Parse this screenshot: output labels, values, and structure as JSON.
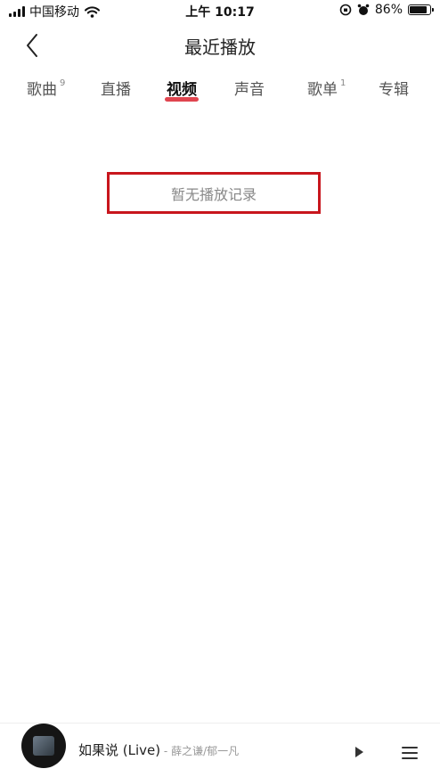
{
  "status_bar": {
    "carrier": "中国移动",
    "time": "上午 10:17",
    "battery": "86%",
    "battery_level": 0.86,
    "icons": [
      "signal-icon",
      "wifi-icon",
      "orientation-lock-icon",
      "alarm-icon",
      "battery-icon"
    ]
  },
  "header": {
    "title": "最近播放",
    "back_icon": "chevron-left-icon"
  },
  "tabs": [
    {
      "label": "歌曲",
      "count": "9"
    },
    {
      "label": "直播",
      "count": ""
    },
    {
      "label": "视频",
      "count": "",
      "active": true
    },
    {
      "label": "声音",
      "count": ""
    },
    {
      "label": "歌单",
      "count": "1"
    },
    {
      "label": "专辑",
      "count": ""
    }
  ],
  "colors": {
    "accent": "#e0454f",
    "highlight_box": "#c8161d"
  },
  "empty_state": {
    "message": "暂无播放记录"
  },
  "player": {
    "song": "如果说 (Live)",
    "separator": " - ",
    "artist": "薛之谦/郁一凡",
    "play_icon": "play-icon",
    "list_icon": "playlist-icon"
  }
}
